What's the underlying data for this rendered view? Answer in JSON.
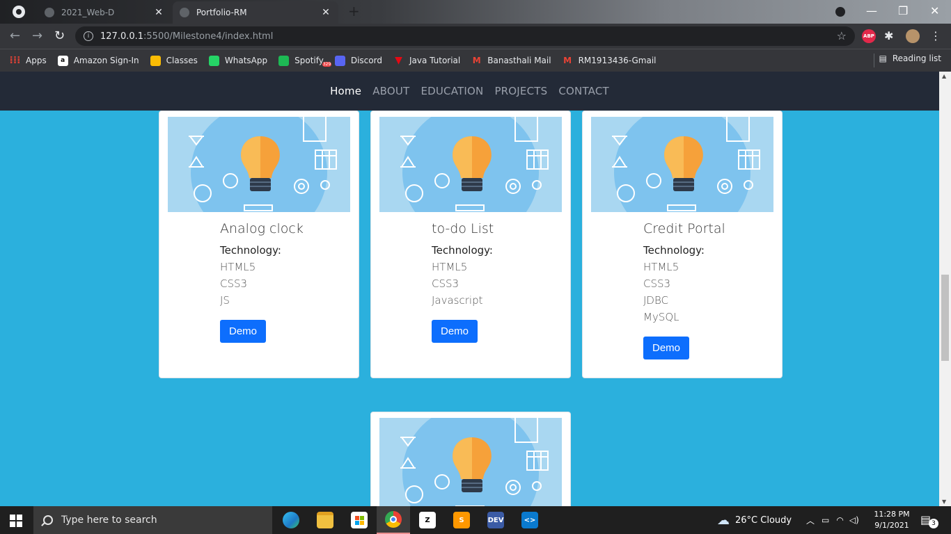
{
  "browser": {
    "tabs": [
      {
        "title": "2021_Web-D",
        "active": false
      },
      {
        "title": "Portfolio-RM",
        "active": true
      }
    ],
    "url_host": "127.0.0.1",
    "url_path": ":5500/Milestone4/index.html",
    "bookmarks": [
      {
        "label": "Apps",
        "icon": "apps-grid-icon",
        "color": "#ea4335"
      },
      {
        "label": "Amazon Sign-In",
        "icon": "amazon-icon",
        "color": "#ffffff"
      },
      {
        "label": "Classes",
        "icon": "classroom-icon",
        "color": "#fbbc04"
      },
      {
        "label": "WhatsApp",
        "icon": "whatsapp-icon",
        "color": "#25d366"
      },
      {
        "label": "Spotify",
        "icon": "spotify-icon",
        "color": "#1db954"
      },
      {
        "label": "Discord",
        "icon": "discord-icon",
        "color": "#5865f2",
        "badge": "329"
      },
      {
        "label": "Java Tutorial",
        "icon": "java-icon",
        "color": "#e50914"
      },
      {
        "label": "Banasthali Mail",
        "icon": "gmail-icon",
        "color": "#ea4335"
      },
      {
        "label": "RM1913436-Gmail",
        "icon": "gmail-icon",
        "color": "#ea4335"
      }
    ],
    "reading_list": "Reading list",
    "abp_label": "ABP"
  },
  "site_nav": {
    "items": [
      "Home",
      "ABOUT",
      "EDUCATION",
      "PROJECTS",
      "CONTACT"
    ]
  },
  "projects": [
    {
      "title": "Analog clock",
      "tech_label": "Technology:",
      "techs": [
        "HTML5",
        "CSS3",
        "JS"
      ],
      "button": "Demo"
    },
    {
      "title": "to-do List",
      "tech_label": "Technology:",
      "techs": [
        "HTML5",
        "CSS3",
        "Javascript"
      ],
      "button": "Demo"
    },
    {
      "title": "Credit Portal",
      "tech_label": "Technology:",
      "techs": [
        "HTML5",
        "CSS3",
        "JDBC",
        "MySQL"
      ],
      "button": "Demo"
    }
  ],
  "taskbar": {
    "search_placeholder": "Type here to search",
    "weather": "26°C  Cloudy",
    "time": "11:28 PM",
    "date": "9/1/2021",
    "notifications": "3",
    "apps": [
      {
        "name": "edge",
        "color": "#1e90d6",
        "letter": "e"
      },
      {
        "name": "file-explorer",
        "color": "#f0c040",
        "letter": ""
      },
      {
        "name": "store",
        "color": "#ffffff",
        "letter": ""
      },
      {
        "name": "chrome",
        "color": "#4285f4",
        "letter": ""
      },
      {
        "name": "zap",
        "color": "#ffffff",
        "letter": "Z"
      },
      {
        "name": "sublime",
        "color": "#ff9800",
        "letter": "S"
      },
      {
        "name": "devcpp",
        "color": "#3b5ba5",
        "letter": "DEV"
      },
      {
        "name": "vscode",
        "color": "#0a7ace",
        "letter": "<>"
      }
    ]
  },
  "colors": {
    "page_bg": "#2bb0dd",
    "nav_bg": "#232a37",
    "button": "#0d6efd"
  }
}
